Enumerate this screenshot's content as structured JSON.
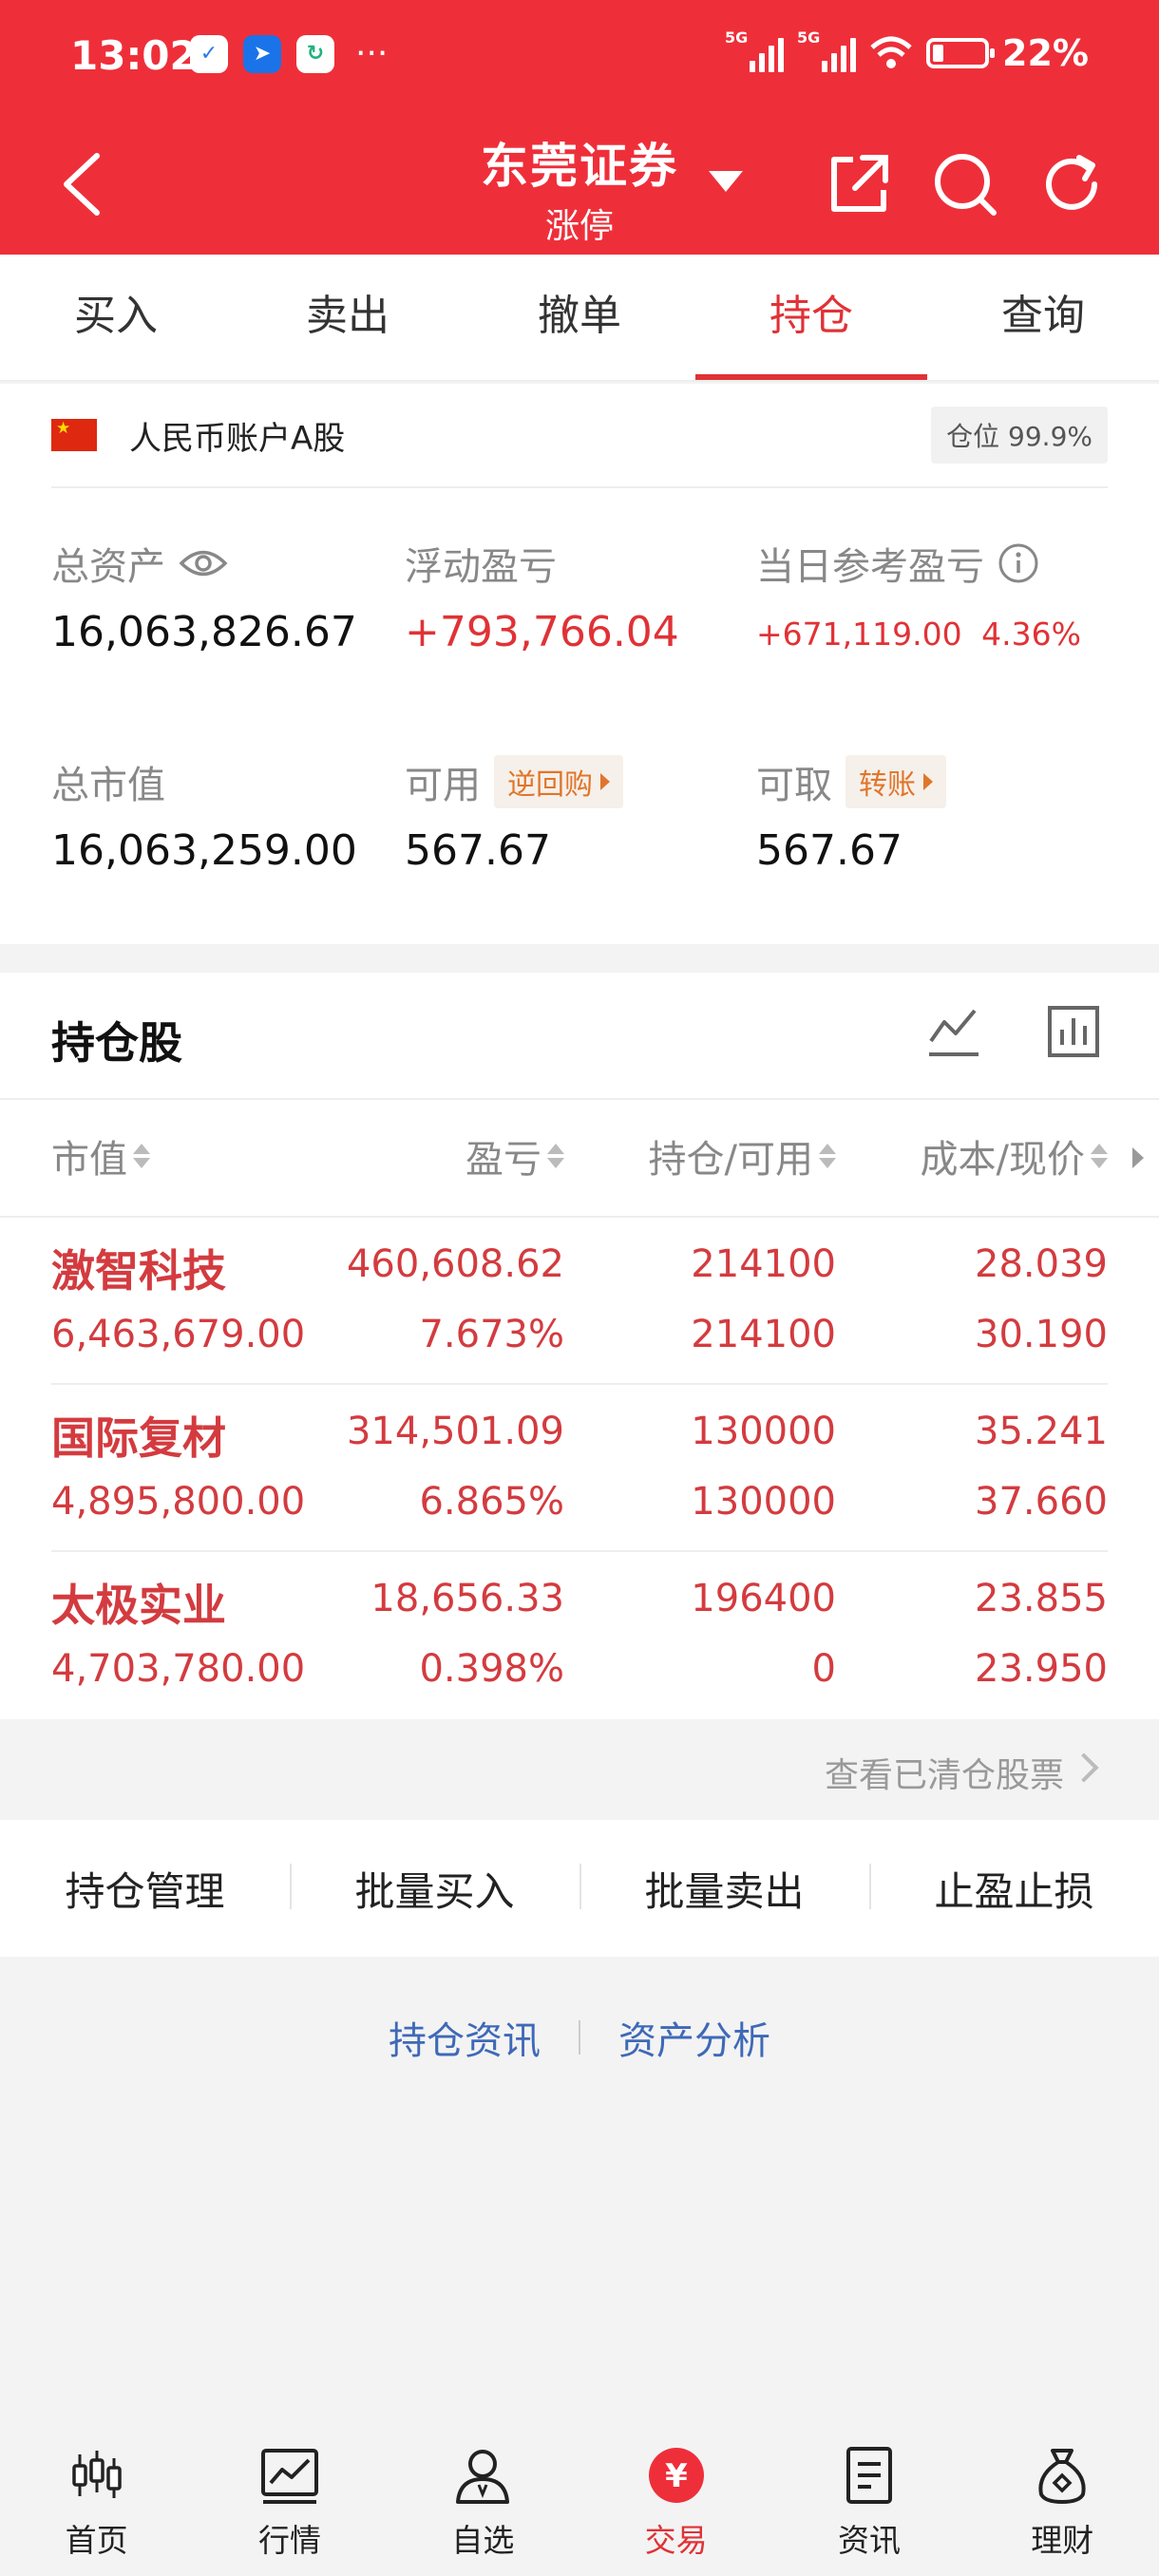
{
  "status_bar": {
    "time": "13:02",
    "more": "···",
    "network_1": "5G",
    "network_2": "5G",
    "battery_level": 0.22,
    "battery_text": "22%"
  },
  "header": {
    "title": "东莞证券",
    "subtitle": "涨停",
    "icons": [
      "back-icon",
      "share-icon",
      "search-icon",
      "refresh-icon"
    ]
  },
  "tabs": [
    {
      "label": "买入",
      "active": false
    },
    {
      "label": "卖出",
      "active": false
    },
    {
      "label": "撤单",
      "active": false
    },
    {
      "label": "持仓",
      "active": true
    },
    {
      "label": "查询",
      "active": false
    }
  ],
  "account": {
    "name": "人民币账户A股",
    "position_badge": "仓位 99.9%",
    "total_assets_label": "总资产",
    "total_assets": "16,063,826.67",
    "floating_pl_label": "浮动盈亏",
    "floating_pl": "+793,766.04",
    "daily_pl_label": "当日参考盈亏",
    "daily_pl": "+671,119.00",
    "daily_pl_pct": "4.36%",
    "market_value_label": "总市值",
    "market_value": "16,063,259.00",
    "available_label": "可用",
    "available": "567.67",
    "reverse_repo_btn": "逆回购",
    "withdrawable_label": "可取",
    "withdrawable": "567.67",
    "transfer_btn": "转账"
  },
  "holdings": {
    "title": "持仓股",
    "columns": [
      "市值",
      "盈亏",
      "持仓/可用",
      "成本/现价"
    ],
    "rows": [
      {
        "name": "激智科技",
        "market_value": "6,463,679.00",
        "pl": "460,608.62",
        "pl_pct": "7.673%",
        "position": "214100",
        "available": "214100",
        "cost": "28.039",
        "price": "30.190"
      },
      {
        "name": "国际复材",
        "market_value": "4,895,800.00",
        "pl": "314,501.09",
        "pl_pct": "6.865%",
        "position": "130000",
        "available": "130000",
        "cost": "35.241",
        "price": "37.660"
      },
      {
        "name": "太极实业",
        "market_value": "4,703,780.00",
        "pl": "18,656.33",
        "pl_pct": "0.398%",
        "position": "196400",
        "available": "0",
        "cost": "23.855",
        "price": "23.950"
      }
    ],
    "cleared_link": "查看已清仓股票"
  },
  "actions": [
    "持仓管理",
    "批量买入",
    "批量卖出",
    "止盈止损"
  ],
  "links": [
    "持仓资讯",
    "资产分析"
  ],
  "bottom_nav": [
    {
      "label": "首页",
      "icon": "candlestick-icon",
      "active": false
    },
    {
      "label": "行情",
      "icon": "chart-icon",
      "active": false
    },
    {
      "label": "自选",
      "icon": "person-icon",
      "active": false
    },
    {
      "label": "交易",
      "icon": "yuan-icon",
      "active": true
    },
    {
      "label": "资讯",
      "icon": "document-icon",
      "active": false
    },
    {
      "label": "理财",
      "icon": "money-bag-icon",
      "active": false
    }
  ],
  "colors": {
    "brand_red": "#ee2f3a",
    "gain_red": "#d33b3f",
    "link_blue": "#3f69b8",
    "accent_orange": "#e0762b"
  }
}
